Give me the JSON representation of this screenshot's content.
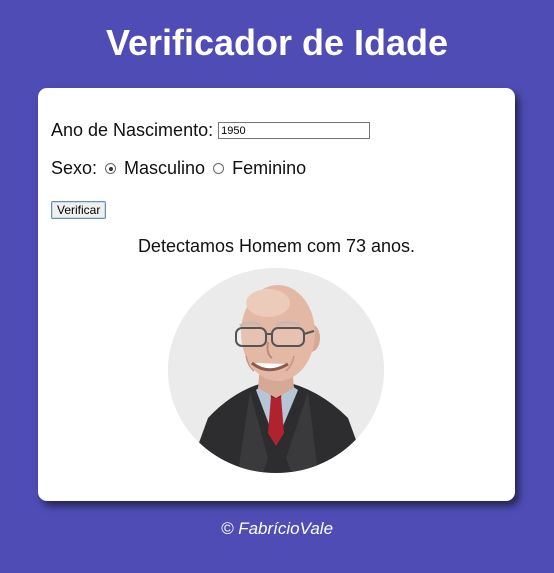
{
  "header": {
    "title": "Verificador de Idade"
  },
  "form": {
    "year_label": "Ano de Nascimento:",
    "year_value": "1950",
    "sex_label": "Sexo:",
    "sex_options": [
      "Masculino",
      "Feminino"
    ],
    "sex_selected": "Masculino",
    "verify_label": "Verificar"
  },
  "result": {
    "text": "Detectamos Homem com 73 anos.",
    "image_icon": "elderly-man-photo"
  },
  "footer": {
    "text": "© FabrícioVale"
  },
  "colors": {
    "background": "#4f4db5",
    "card": "#ffffff",
    "title": "#ffffff"
  }
}
